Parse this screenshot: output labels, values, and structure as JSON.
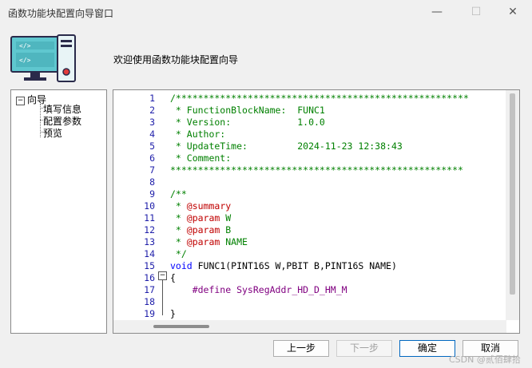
{
  "window": {
    "title": "函数功能块配置向导窗口",
    "min_glyph": "—",
    "max_glyph": "☐",
    "close_glyph": "✕"
  },
  "header": {
    "welcome": "欢迎使用函数功能块配置向导"
  },
  "tree": {
    "root": {
      "label": "向导",
      "expander": "⊟"
    },
    "children": [
      "填写信息",
      "配置参数",
      "预览"
    ]
  },
  "editor": {
    "fold_glyph": "⊟",
    "line_numbers": [
      "1",
      "2",
      "3",
      "4",
      "5",
      "6",
      "7",
      "8",
      "9",
      "10",
      "11",
      "12",
      "13",
      "14",
      "15",
      "16",
      "17",
      "18",
      "19"
    ],
    "lines": [
      [
        {
          "t": "/*****************************************************",
          "c": "cm"
        }
      ],
      [
        {
          "t": " * FunctionBlockName:  FUNC1",
          "c": "cm"
        }
      ],
      [
        {
          "t": " * Version:            1.0.0",
          "c": "cm"
        }
      ],
      [
        {
          "t": " * Author:",
          "c": "cm"
        }
      ],
      [
        {
          "t": " * UpdateTime:         2024-11-23 12:38:43",
          "c": "cm"
        }
      ],
      [
        {
          "t": " * Comment:",
          "c": "cm"
        }
      ],
      [
        {
          "t": "*****************************************************",
          "c": "cm"
        }
      ],
      [
        {
          "t": "",
          "c": ""
        }
      ],
      [
        {
          "t": "/**",
          "c": "cm"
        }
      ],
      [
        {
          "t": " * ",
          "c": "cm"
        },
        {
          "t": "@summary",
          "c": "tag"
        }
      ],
      [
        {
          "t": " * ",
          "c": "cm"
        },
        {
          "t": "@param",
          "c": "tag"
        },
        {
          "t": " W",
          "c": "cm"
        }
      ],
      [
        {
          "t": " * ",
          "c": "cm"
        },
        {
          "t": "@param",
          "c": "tag"
        },
        {
          "t": " B",
          "c": "cm"
        }
      ],
      [
        {
          "t": " * ",
          "c": "cm"
        },
        {
          "t": "@param",
          "c": "tag"
        },
        {
          "t": " NAME",
          "c": "cm"
        }
      ],
      [
        {
          "t": " */",
          "c": "cm"
        }
      ],
      [
        {
          "t": "void",
          "c": "kw"
        },
        {
          "t": " FUNC1(PINT16S W,PBIT B,PINT16S NAME)",
          "c": ""
        }
      ],
      [
        {
          "t": "{",
          "c": ""
        }
      ],
      [
        {
          "t": "    #define SysRegAddr_HD_D_HM_M",
          "c": "pp"
        }
      ],
      [
        {
          "t": "",
          "c": ""
        }
      ],
      [
        {
          "t": "}",
          "c": ""
        }
      ]
    ]
  },
  "buttons": {
    "prev": "上一步",
    "next": "下一步",
    "ok": "确定",
    "cancel": "取消"
  },
  "watermark": "CSDN @贰佰肆拾"
}
